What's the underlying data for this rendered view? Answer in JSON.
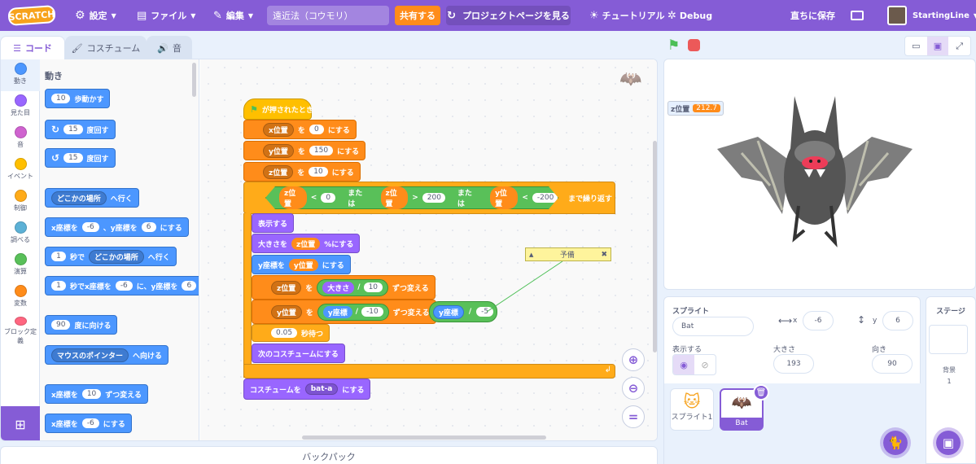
{
  "menubar": {
    "logo": "SCRATCH",
    "settings": "設定",
    "file": "ファイル",
    "edit": "編集",
    "project_title": "遠近法（コウモリ）",
    "share": "共有する",
    "see_project_page": "プロジェクトページを見る",
    "tutorials": "チュートリアル",
    "debug": "Debug",
    "save_now": "直ちに保存",
    "username": "StartingLine"
  },
  "tabs": {
    "code": "コード",
    "costumes": "コスチューム",
    "sounds": "音"
  },
  "categories": [
    "動き",
    "見た目",
    "音",
    "イベント",
    "制御",
    "調べる",
    "演算",
    "変数",
    "ブロック定義"
  ],
  "category_colors": [
    "#4c97ff",
    "#9966ff",
    "#cf63cf",
    "#ffbf00",
    "#ffab19",
    "#5cb1d6",
    "#59c059",
    "#ff8c1a",
    "#ff6680"
  ],
  "palette": {
    "header": "動き",
    "b1_n": "10",
    "b1_t": "歩動かす",
    "b2_n": "15",
    "b2_t": "度回す",
    "b3_n": "15",
    "b3_t": "度回す",
    "b4_d": "どこかの場所",
    "b4_t": "へ行く",
    "b5_a": "x座標を",
    "b5_x": "-6",
    "b5_b": "、y座標を",
    "b5_y": "6",
    "b5_c": "にする",
    "b6_n": "1",
    "b6_a": "秒で",
    "b6_d": "どこかの場所",
    "b6_t": "へ行く",
    "b7_n": "1",
    "b7_a": "秒でx座標を",
    "b7_x": "-6",
    "b7_b": "に、y座標を",
    "b7_y": "6",
    "b8_n": "90",
    "b8_t": "度に向ける",
    "b9_d": "マウスのポインター",
    "b9_t": "へ向ける",
    "b10_a": "x座標を",
    "b10_n": "10",
    "b10_t": "ずつ変える",
    "b11_a": "x座標を",
    "b11_n": "-6",
    "b11_t": "にする"
  },
  "script": {
    "hat": "が押されたとき",
    "s1_var": "x位置",
    "s1_a": "を",
    "s1_v": "0",
    "s1_b": "にする",
    "s2_var": "y位置",
    "s2_a": "を",
    "s2_v": "150",
    "s2_b": "にする",
    "s3_var": "z位置",
    "s3_a": "を",
    "s3_v": "10",
    "s3_b": "にする",
    "c1_var": "z位置",
    "c1_op": "<",
    "c1_v": "0",
    "or1": "または",
    "c2_var": "z位置",
    "c2_op": ">",
    "c2_v": "200",
    "or2": "または",
    "c3_var": "y位置",
    "c3_op": "<",
    "c3_v": "-200",
    "repeat_until": "まで繰り返す",
    "show": "表示する",
    "size_a": "大きさを",
    "size_var": "z位置",
    "size_b": "%にする",
    "sety_a": "y座標を",
    "sety_var": "y位置",
    "sety_b": "にする",
    "chz_var": "z位置",
    "chz_a": "を",
    "chz_r1": "大きさ",
    "chz_div": "/",
    "chz_r2": "10",
    "chz_b": "ずつ変える",
    "chy_var": "y位置",
    "chy_a": "を",
    "chy_r1": "y座標",
    "chy_div": "/",
    "chy_r2": "-10",
    "chy_b": "ずつ変える",
    "wait_v": "0.05",
    "wait_t": "秒待つ",
    "next_costume": "次のコスチュームにする",
    "cost_a": "コスチュームを",
    "cost_d": "bat-a",
    "cost_b": "にする",
    "loose_r1": "y座標",
    "loose_div": "/",
    "loose_r2": "-5",
    "comment": "予備"
  },
  "backpack": "バックパック",
  "monitor": {
    "label": "z位置",
    "value": "212.7"
  },
  "sprite_info": {
    "sprite_label": "スプライト",
    "sprite_name": "Bat",
    "x_label": "x",
    "x": "-6",
    "y_label": "y",
    "y": "6",
    "show_label": "表示する",
    "size_label": "大きさ",
    "size": "193",
    "direction_label": "向き",
    "direction": "90"
  },
  "sprites": [
    {
      "name": "スプライト1"
    },
    {
      "name": "Bat"
    }
  ],
  "stage_panel": {
    "title": "ステージ",
    "backdrops_label": "背景",
    "backdrops": "1"
  }
}
